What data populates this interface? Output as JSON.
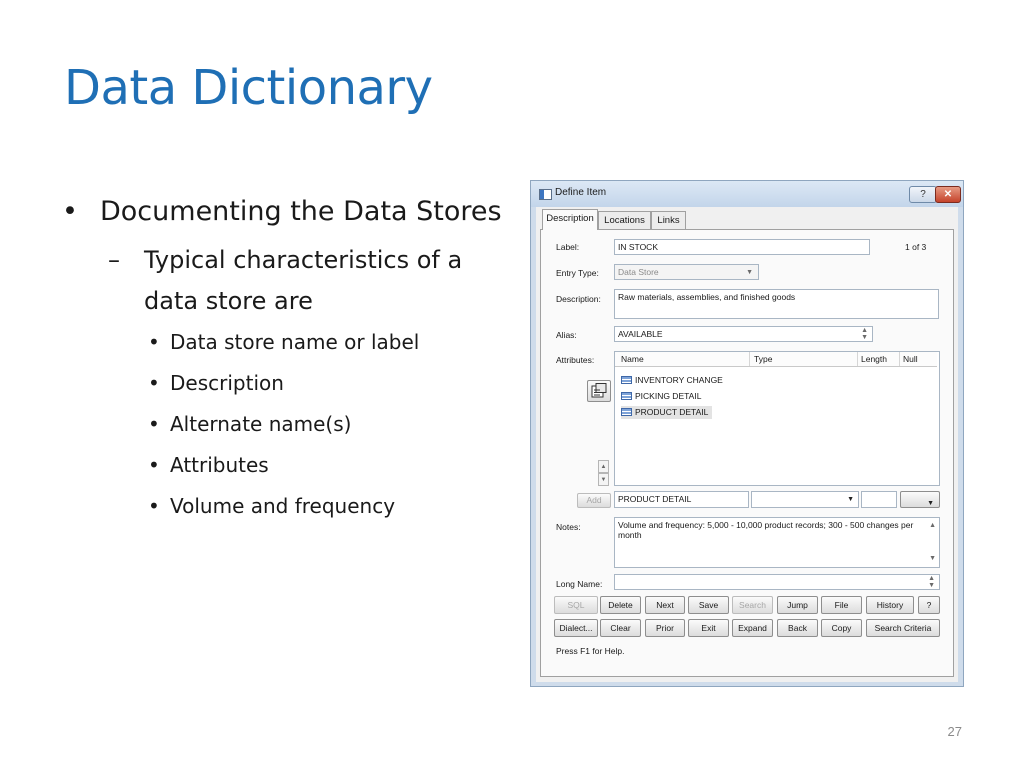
{
  "slide": {
    "title": "Data Dictionary",
    "bullets": {
      "level1": "Documenting the Data Stores",
      "level2": "Typical characteristics of a data store are",
      "level3": [
        "Data store name or label",
        "Description",
        "Alternate name(s)",
        "Attributes",
        "Volume and frequency"
      ]
    },
    "page_number": "27",
    "colors": {
      "title": "#1f6fb5",
      "text": "#1a1a1a"
    }
  },
  "dialog": {
    "title": "Define Item",
    "help_button": "?",
    "close_button": "✕",
    "tabs": [
      "Description",
      "Locations",
      "Links"
    ],
    "active_tab": "Description",
    "label_caption": "Label:",
    "label_value": "IN STOCK",
    "record_counter": "1 of 3",
    "entry_type_caption": "Entry Type:",
    "entry_type_value": "Data Store",
    "description_caption": "Description:",
    "description_value": "Raw materials, assemblies, and finished goods",
    "alias_caption": "Alias:",
    "alias_value": "AVAILABLE",
    "attributes_caption": "Attributes:",
    "attributes_columns": [
      "Name",
      "Type",
      "Length",
      "Null"
    ],
    "attributes_rows": [
      "INVENTORY CHANGE",
      "PICKING DETAIL",
      "PRODUCT DETAIL"
    ],
    "selected_row": "PRODUCT DETAIL",
    "add_button": "Add",
    "attribute_name_value": "PRODUCT DETAIL",
    "notes_caption": "Notes:",
    "notes_value": "Volume and frequency: 5,000 - 10,000 product records; 300 - 500 changes per month",
    "long_name_caption": "Long Name:",
    "long_name_value": "",
    "buttons_row1": [
      "SQL",
      "Delete",
      "Next",
      "Save",
      "Search",
      "Jump",
      "File",
      "History",
      "?"
    ],
    "buttons_row2": [
      "Dialect...",
      "Clear",
      "Prior",
      "Exit",
      "Expand",
      "Back",
      "Copy",
      "Search Criteria"
    ],
    "disabled_buttons": [
      "SQL",
      "Search",
      "Add"
    ],
    "status_text": "Press F1 for Help."
  }
}
